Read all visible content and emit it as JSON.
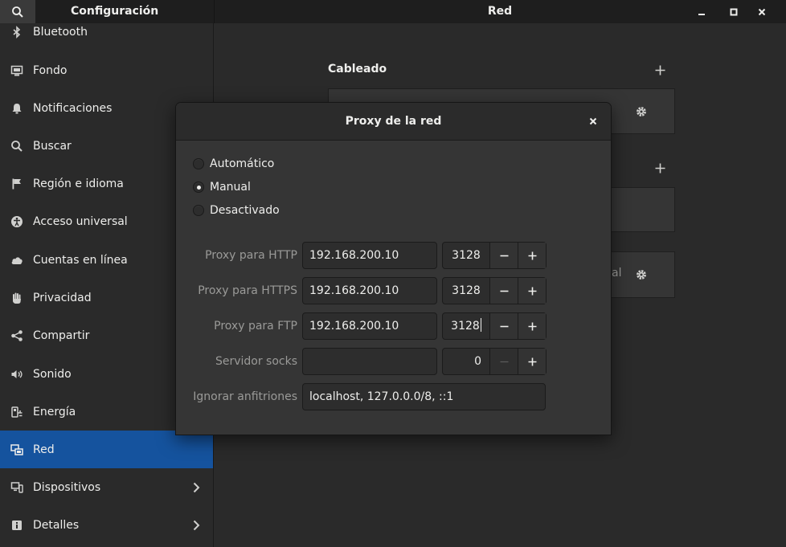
{
  "titlebar": {
    "app_title": "Configuración",
    "page_title": "Red"
  },
  "sidebar": {
    "items": [
      {
        "label": "Bluetooth",
        "icon": "bluetooth-icon"
      },
      {
        "label": "Fondo",
        "icon": "background-icon"
      },
      {
        "label": "Notificaciones",
        "icon": "bell-icon"
      },
      {
        "label": "Buscar",
        "icon": "search-icon"
      },
      {
        "label": "Región e idioma",
        "icon": "flag-icon"
      },
      {
        "label": "Acceso universal",
        "icon": "accessibility-icon"
      },
      {
        "label": "Cuentas en línea",
        "icon": "cloud-icon"
      },
      {
        "label": "Privacidad",
        "icon": "hand-icon"
      },
      {
        "label": "Compartir",
        "icon": "share-icon"
      },
      {
        "label": "Sonido",
        "icon": "speaker-icon"
      },
      {
        "label": "Energía",
        "icon": "power-plug-icon"
      },
      {
        "label": "Red",
        "icon": "network-icon",
        "active": true
      },
      {
        "label": "Dispositivos",
        "icon": "devices-icon"
      },
      {
        "label": "Detalles",
        "icon": "info-icon"
      }
    ]
  },
  "main": {
    "wired_section_title": "Cableado",
    "card_partial_text": "al"
  },
  "dialog": {
    "title": "Proxy de la red",
    "modes": [
      {
        "label": "Automático",
        "selected": false
      },
      {
        "label": "Manual",
        "selected": true
      },
      {
        "label": "Desactivado",
        "selected": false
      }
    ],
    "http": {
      "label": "Proxy para HTTP",
      "host": "192.168.200.10",
      "port": "3128"
    },
    "https": {
      "label": "Proxy para HTTPS",
      "host": "192.168.200.10",
      "port": "3128"
    },
    "ftp": {
      "label": "Proxy para FTP",
      "host": "192.168.200.10",
      "port": "3128"
    },
    "socks": {
      "label": "Servidor socks",
      "host": "",
      "port": "0"
    },
    "ignore": {
      "label": "Ignorar anfitriones",
      "value": "localhost, 127.0.0.0/8, ::1"
    }
  },
  "colors": {
    "accent": "#15539e",
    "background": "#2a2a2a",
    "dialog": "#353535",
    "text": "#eeeeec",
    "dim_text": "#9a9a98"
  }
}
